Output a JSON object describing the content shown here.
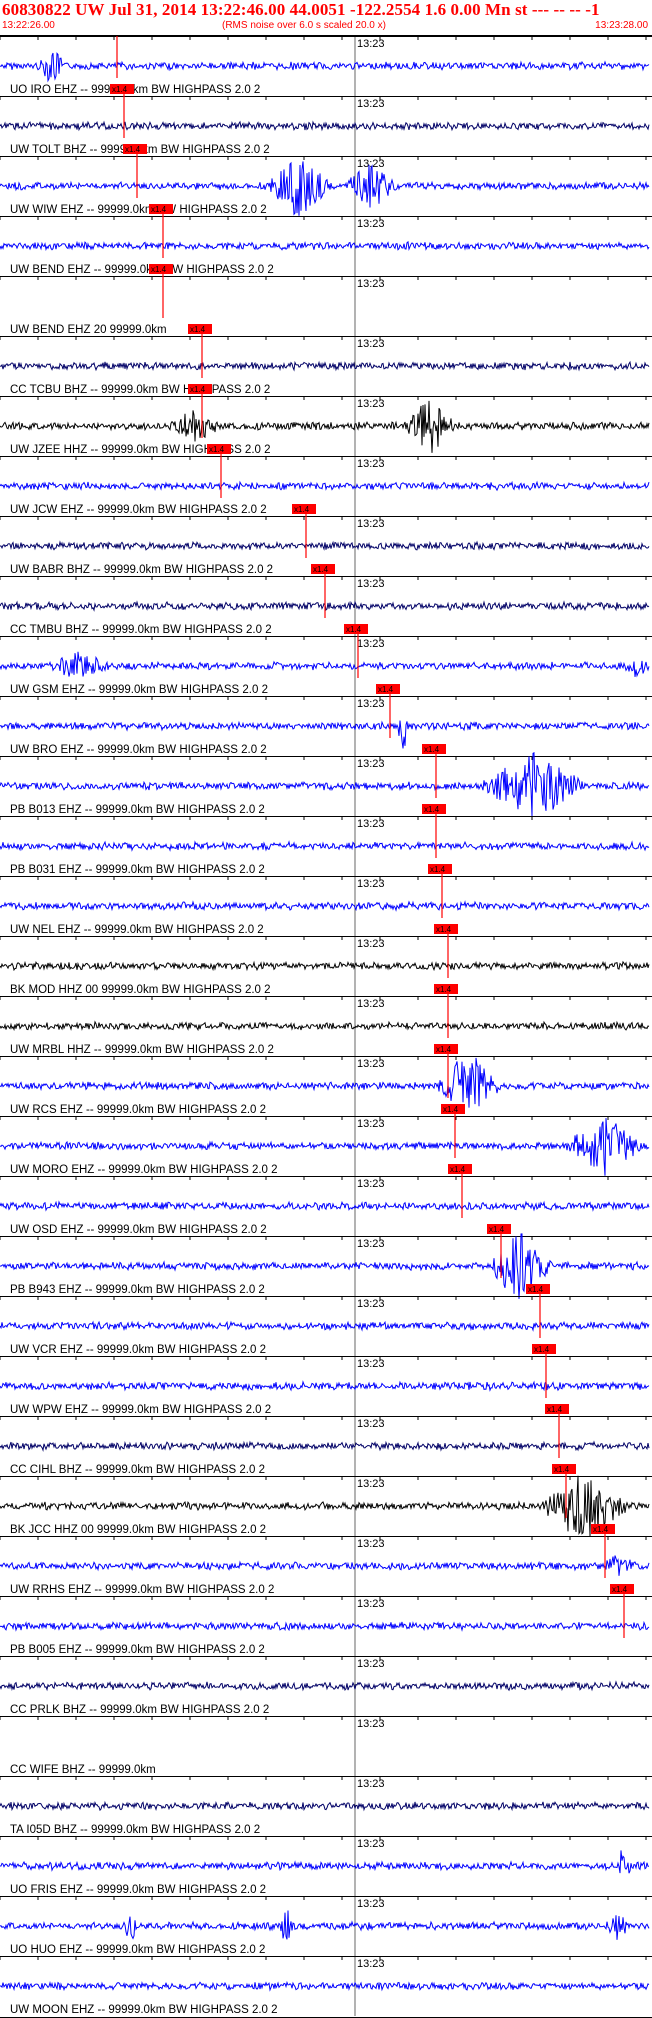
{
  "header": {
    "title": "60830822 UW Jul 31, 2014 13:22:46.00   44.0051 -122.2554  1.6 0.00 Mn st --- -- --  -1",
    "start_time": "13:22:26.00",
    "note": "(RMS noise over 6.0 s scaled 20.0 x)",
    "end_time": "13:23:28.00",
    "tick_label": "13:23",
    "pick_label": "x1.4",
    "colors": {
      "header_text": "#ff0000",
      "pick": "#ff0000",
      "blue_trace": "#0000ff",
      "black_trace": "#000000",
      "navy_trace": "#000066"
    }
  },
  "traces": [
    {
      "label": "UO IRO EHZ -- 99999.0km BW  HIGHPASS  2.0  2",
      "color": "blue",
      "pick": 0.18
    },
    {
      "label": "UW TOLT BHZ -- 99999.0km BW  HIGHPASS  2.0  2",
      "color": "navy",
      "pick": 0.19
    },
    {
      "label": "UW WIW EHZ -- 99999.0km BW  HIGHPASS  2.0  2",
      "color": "blue",
      "pick": 0.21
    },
    {
      "label": "UW BEND EHZ -- 99999.0km BW  HIGHPASS  2.0  2",
      "color": "blue",
      "pick": 0.25
    },
    {
      "label": "UW BEND EHZ 20 99999.0km",
      "color": "none",
      "pick": 0.25
    },
    {
      "label": "CC TCBU BHZ -- 99999.0km BW  HIGHPASS  2.0  2",
      "color": "navy",
      "pick": 0.31
    },
    {
      "label": "UW JZEE HHZ -- 99999.0km BW  HIGHPASS  2.0  2",
      "color": "black",
      "pick": 0.31
    },
    {
      "label": "UW JCW EHZ -- 99999.0km BW  HIGHPASS  2.0  2",
      "color": "blue",
      "pick": 0.34
    },
    {
      "label": "UW BABR BHZ -- 99999.0km BW  HIGHPASS  2.0  2",
      "color": "navy",
      "pick": 0.47
    },
    {
      "label": "CC TMBU BHZ -- 99999.0km BW  HIGHPASS  2.0  2",
      "color": "navy",
      "pick": 0.5
    },
    {
      "label": "UW GSM EHZ -- 99999.0km BW  HIGHPASS  2.0  2",
      "color": "blue",
      "pick": 0.55
    },
    {
      "label": "UW BRO EHZ -- 99999.0km BW  HIGHPASS  2.0  2",
      "color": "blue",
      "pick": 0.6
    },
    {
      "label": "PB B013 EHZ -- 99999.0km BW  HIGHPASS  2.0  2",
      "color": "blue",
      "pick": 0.67
    },
    {
      "label": "PB B031 EHZ -- 99999.0km BW  HIGHPASS  2.0  2",
      "color": "blue",
      "pick": 0.67
    },
    {
      "label": "UW NEL EHZ -- 99999.0km BW  HIGHPASS  2.0  2",
      "color": "blue",
      "pick": 0.68
    },
    {
      "label": "BK MOD HHZ 00 99999.0km BW  HIGHPASS  2.0  2",
      "color": "black",
      "pick": 0.69
    },
    {
      "label": "UW MRBL HHZ -- 99999.0km BW  HIGHPASS  2.0  2",
      "color": "black",
      "pick": 0.69
    },
    {
      "label": "UW RCS EHZ -- 99999.0km BW  HIGHPASS  2.0  2",
      "color": "blue",
      "pick": 0.69
    },
    {
      "label": "UW MORO EHZ -- 99999.0km BW  HIGHPASS  2.0  2",
      "color": "blue",
      "pick": 0.7
    },
    {
      "label": "UW OSD EHZ -- 99999.0km BW  HIGHPASS  2.0  2",
      "color": "blue",
      "pick": 0.71
    },
    {
      "label": "PB B943 EHZ -- 99999.0km BW  HIGHPASS  2.0  2",
      "color": "blue",
      "pick": 0.77
    },
    {
      "label": "UW VCR EHZ -- 99999.0km BW  HIGHPASS  2.0  2",
      "color": "blue",
      "pick": 0.83
    },
    {
      "label": "UW WPW EHZ -- 99999.0km BW  HIGHPASS  2.0  2",
      "color": "blue",
      "pick": 0.84
    },
    {
      "label": "CC CIHL BHZ -- 99999.0km BW  HIGHPASS  2.0  2",
      "color": "navy",
      "pick": 0.86
    },
    {
      "label": "BK JCC HHZ 00 99999.0km BW  HIGHPASS  2.0  2",
      "color": "black",
      "pick": 0.87
    },
    {
      "label": "UW RRHS EHZ -- 99999.0km BW  HIGHPASS  2.0  2",
      "color": "blue",
      "pick": 0.93
    },
    {
      "label": "PB B005 EHZ -- 99999.0km BW  HIGHPASS  2.0  2",
      "color": "blue",
      "pick": 0.96
    },
    {
      "label": "CC PRLK BHZ -- 99999.0km BW  HIGHPASS  2.0  2",
      "color": "navy",
      "pick": null
    },
    {
      "label": "CC WIFE BHZ -- 99999.0km",
      "color": "none",
      "pick": null
    },
    {
      "label": "TA I05D BHZ -- 99999.0km BW  HIGHPASS  2.0  2",
      "color": "navy",
      "pick": null
    },
    {
      "label": "UO FRIS EHZ -- 99999.0km BW  HIGHPASS  2.0  2",
      "color": "blue",
      "pick": null
    },
    {
      "label": "UO HUO EHZ -- 99999.0km BW  HIGHPASS  2.0  2",
      "color": "blue",
      "pick": null
    },
    {
      "label": "UW MOON EHZ -- 99999.0km BW  HIGHPASS  2.0  2",
      "color": "blue",
      "pick": null
    }
  ]
}
